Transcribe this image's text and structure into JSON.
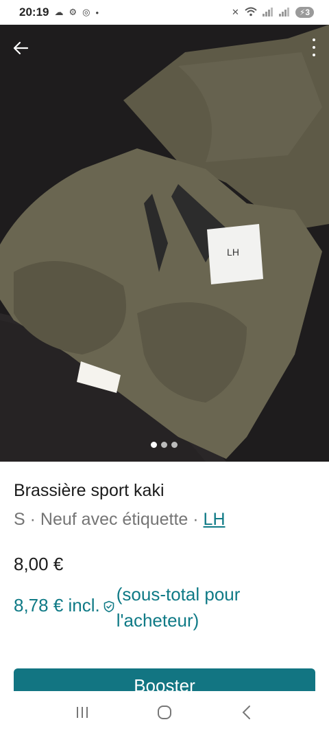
{
  "status_bar": {
    "time": "20:19",
    "battery": "3"
  },
  "product": {
    "title": "Brassière sport kaki",
    "size": "S",
    "separator": " · ",
    "condition": "Neuf avec étiquette",
    "brand": "LH",
    "price": "8,00 €",
    "price_incl": "8,78 € incl.",
    "price_incl_note": "(sous-total pour l'acheteur)",
    "tag_text": "LH"
  },
  "gallery": {
    "image_count": 3,
    "active_index": 0
  },
  "actions": {
    "booster_label": "Booster"
  },
  "colors": {
    "accent": "#127582",
    "link": "#0f7a86"
  }
}
